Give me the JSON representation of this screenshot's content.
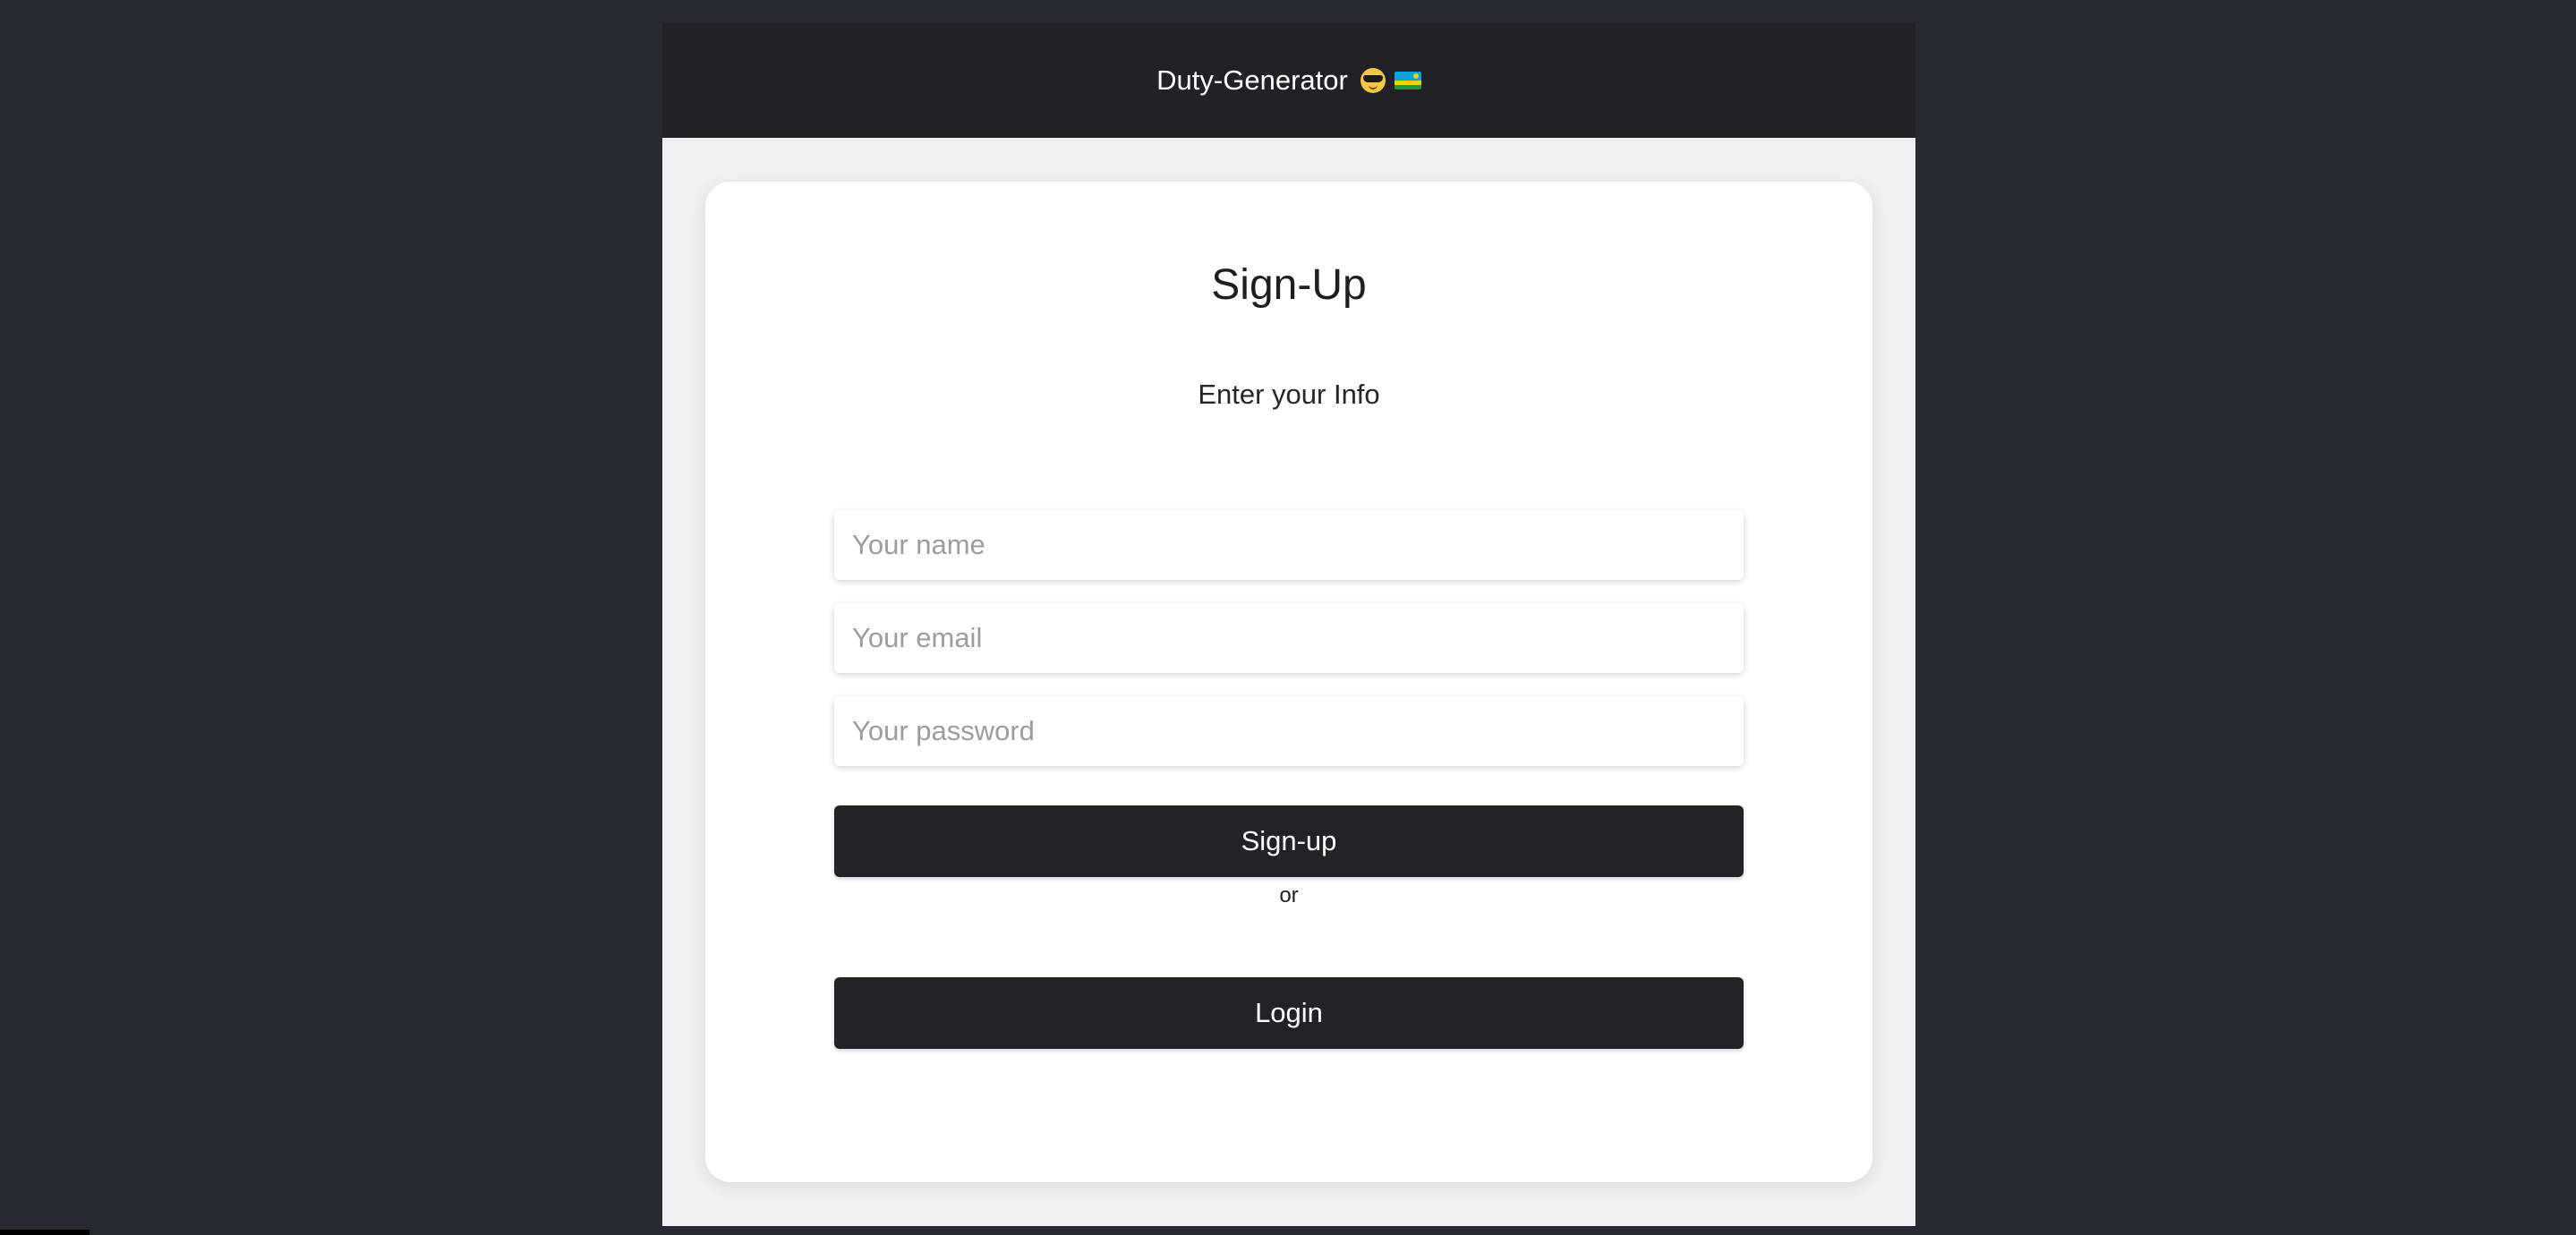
{
  "header": {
    "title": "Duty-Generator",
    "emoji_icons": [
      "smiling-face-with-sunglasses-icon",
      "rwanda-flag-icon"
    ]
  },
  "form": {
    "heading": "Sign-Up",
    "subheading": "Enter your Info",
    "name_placeholder": "Your name",
    "email_placeholder": "Your email",
    "password_placeholder": "Your password",
    "signup_label": "Sign-up",
    "or_label": "or",
    "login_label": "Login"
  },
  "colors": {
    "background": "#272a31",
    "header": "#212227",
    "button": "#222328",
    "card": "#ffffff",
    "page": "#f0f1f3"
  }
}
